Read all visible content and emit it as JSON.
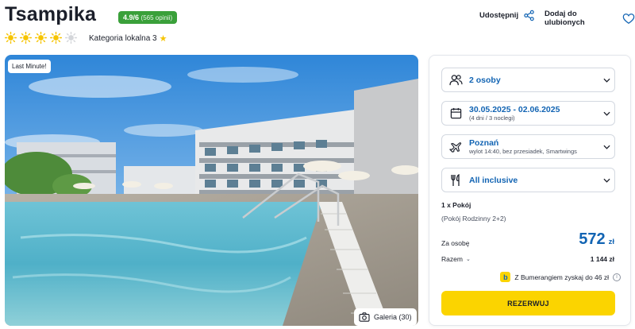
{
  "hotel": {
    "name": "Tsampika",
    "rating_score": "4.9/6",
    "rating_count": "(565 opinii)",
    "sun_rating": 4,
    "sun_max": 5,
    "category_label": "Kategoria lokalna 3",
    "category_star": "★"
  },
  "actions": {
    "share_label": "Udostępnij",
    "favorite_label": "Dodaj do ulubionych"
  },
  "photo": {
    "badge": "Last Minute!",
    "gallery_label": "Galeria (30)"
  },
  "booking": {
    "persons": "2 osoby",
    "dates": "30.05.2025 - 02.06.2025",
    "duration": "(4 dni / 3 noclegi)",
    "departure_city": "Poznań",
    "flight_info": "wylot 14:40, bez przesiadek, Smartwings",
    "board": "All inclusive",
    "room_count": "1 x Pokój",
    "room_type": "(Pokój Rodzinny 2+2)",
    "per_person_label": "Za osobę",
    "price": "572",
    "currency": "zł",
    "total_label": "Razem",
    "total_value": "1 144 zł",
    "bumerang_text": "Z Bumerangiem zyskaj do 46 zł",
    "bumerang_logo": "b",
    "reserve_label": "REZERWUJ"
  },
  "colors": {
    "accent_blue": "#1264b3",
    "rating_green": "#3aa03a",
    "sun_yellow": "#f6c400",
    "button_yellow": "#fbd400"
  }
}
